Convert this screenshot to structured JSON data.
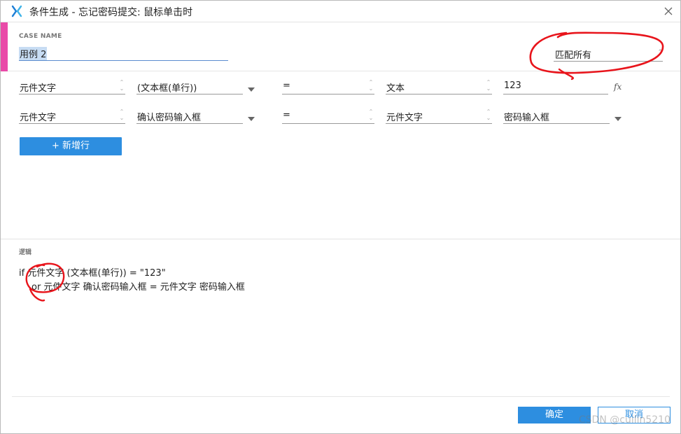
{
  "titlebar": {
    "title": "条件生成  -  忘记密码提交: 鼠标单击时"
  },
  "case": {
    "label": "CASE NAME",
    "name": "用例 2",
    "match_mode": "匹配所有"
  },
  "conditions": [
    {
      "target": "元件文字",
      "object": "(文本框(单行))",
      "operator": "=",
      "value_type": "文本",
      "value": "123"
    },
    {
      "target": "元件文字",
      "object": "确认密码输入框",
      "operator": "=",
      "value_type": "元件文字",
      "value": "密码输入框"
    }
  ],
  "add_row_label": "+ 新增行",
  "logic": {
    "label": "逻辑",
    "line1": "if 元件文字 (文本框(单行)) = \"123\"",
    "line2": "or 元件文字 确认密码输入框 = 元件文字 密码输入框"
  },
  "footer": {
    "ok_label": "确定",
    "cancel_label": "取消",
    "watermark": "CSDN @cuilin5210"
  },
  "colors": {
    "accent_pink": "#e94aa8",
    "primary_blue": "#2d8ee0",
    "annotation_red": "#e8141b"
  },
  "icons": {
    "app": "axure-x-icon",
    "close": "close-icon",
    "fx": "function-fx-icon"
  }
}
